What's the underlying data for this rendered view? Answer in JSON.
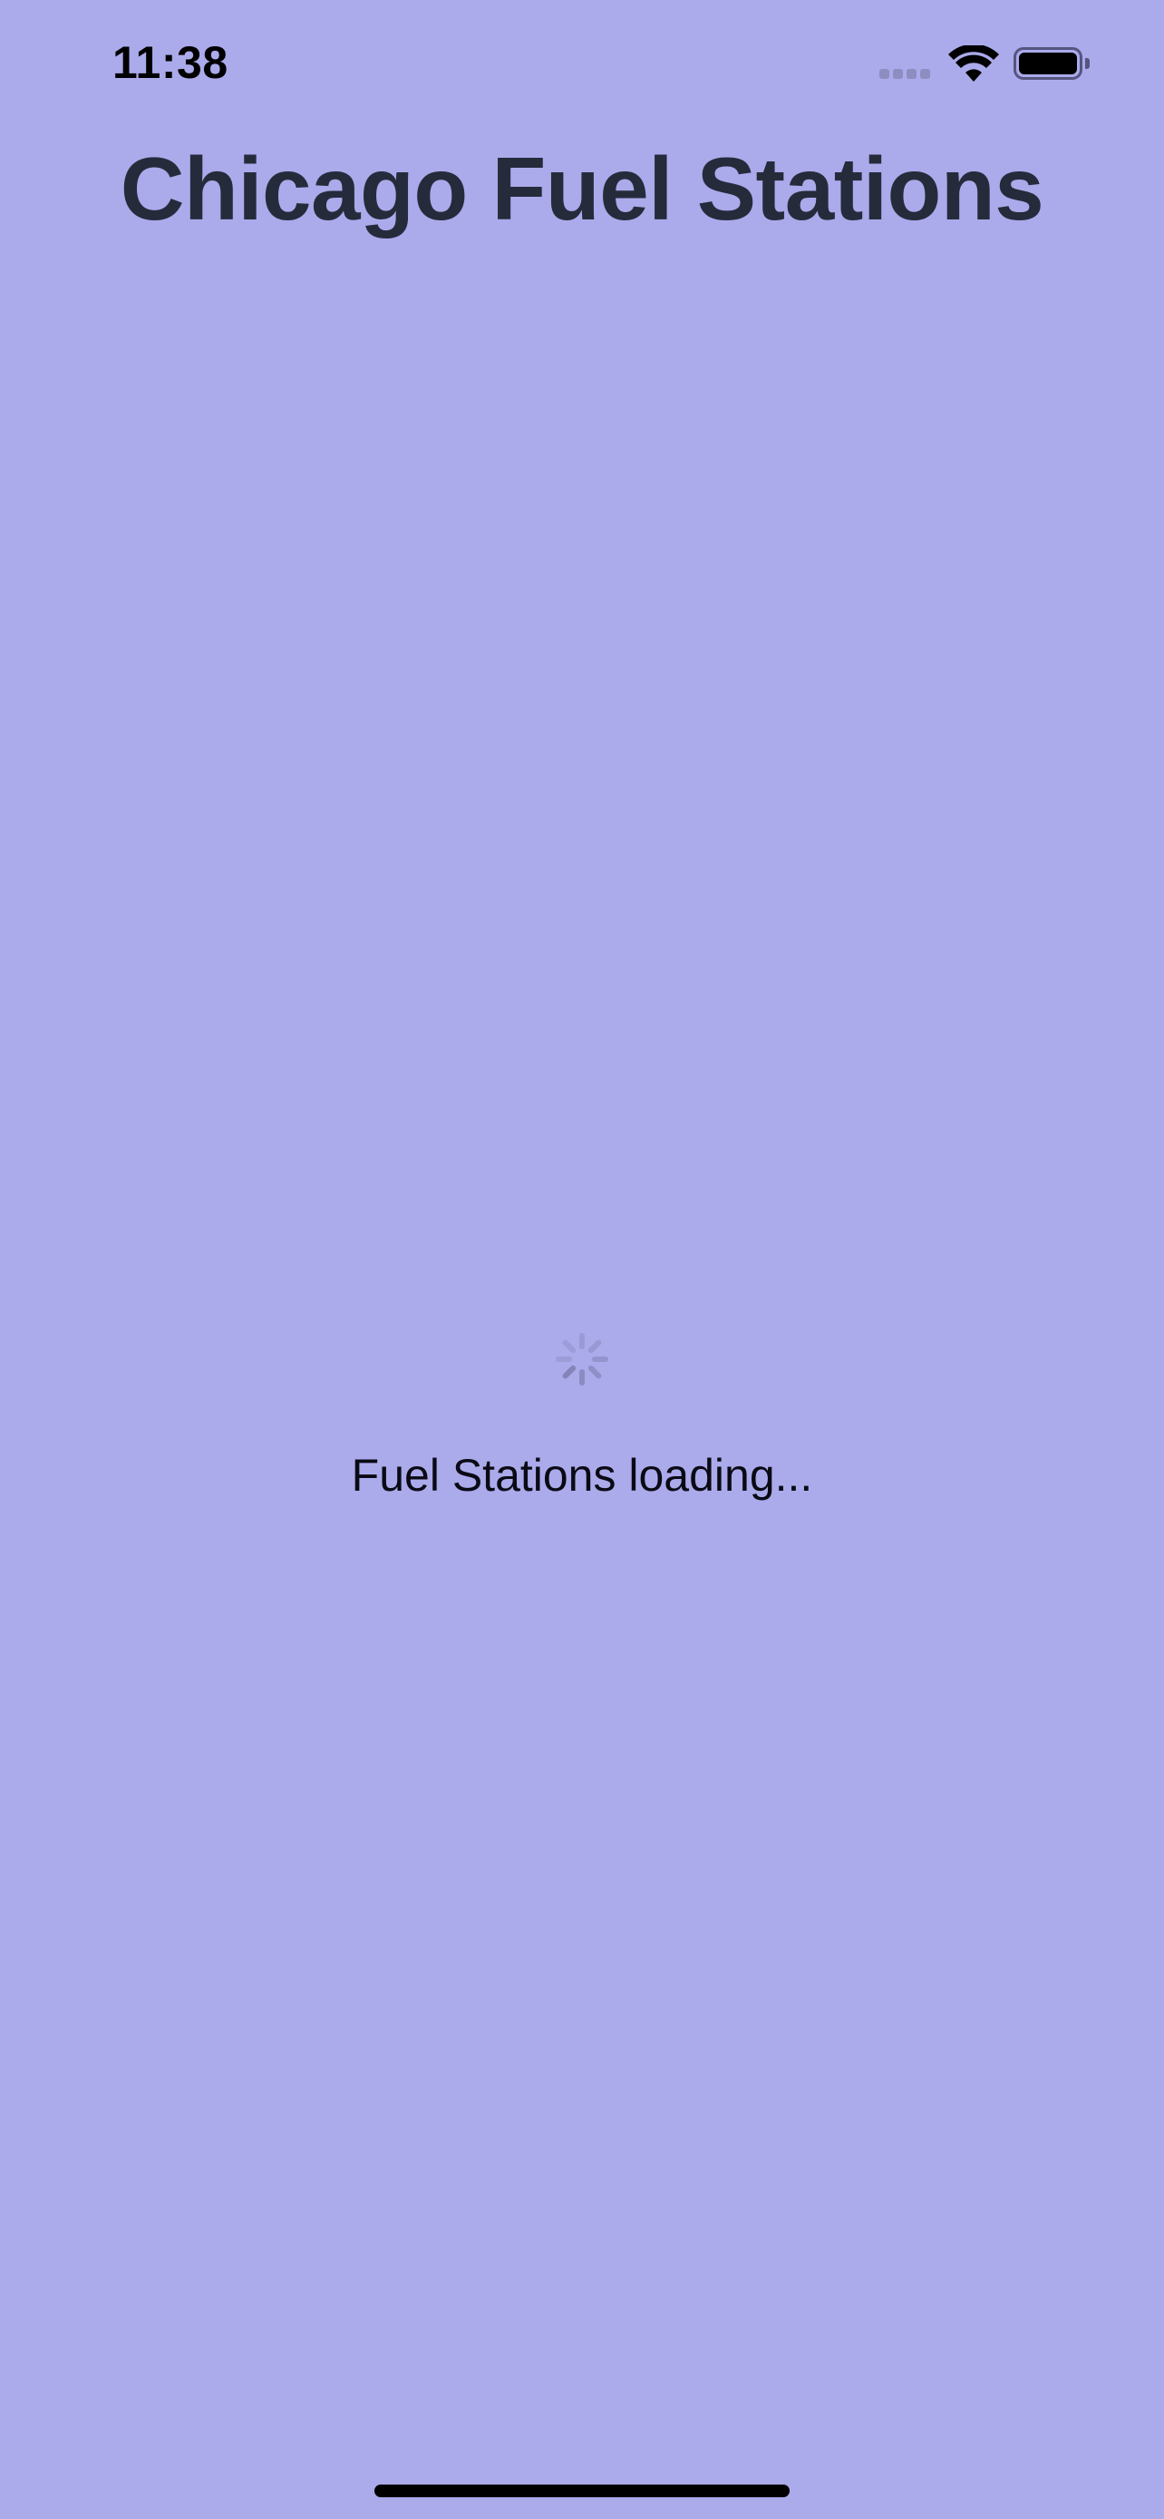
{
  "status_bar": {
    "time": "11:38",
    "icons": [
      "signal-icon",
      "wifi-icon",
      "battery-icon"
    ]
  },
  "header": {
    "title": "Chicago Fuel Stations"
  },
  "loading": {
    "message": "Fuel Stations loading...",
    "icon": "spinner-icon"
  },
  "colors": {
    "background": "#ABAAEB",
    "title": "#262B3B",
    "text": "#0A0A14",
    "spinner": "#7F7EB0"
  }
}
